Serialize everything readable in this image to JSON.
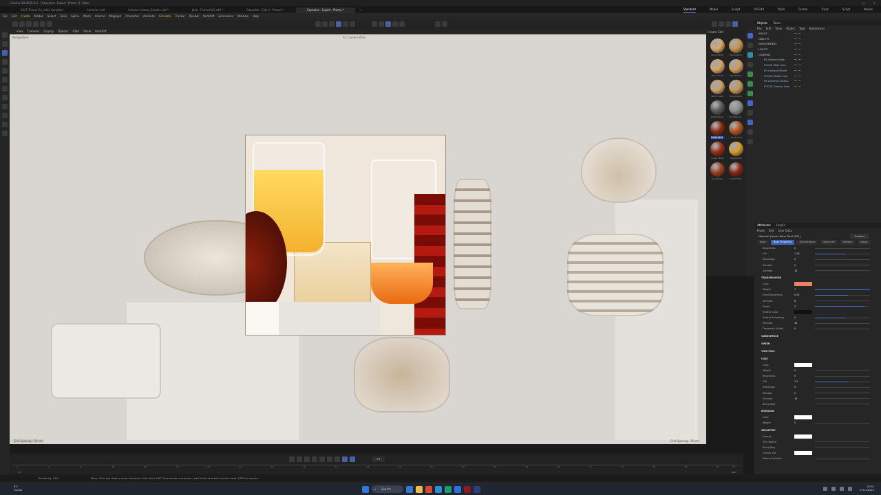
{
  "window": {
    "title": "Cinema 4D 2025.0.2 - [Capsules - Liquid - Promo *] - Main",
    "controls": [
      "–",
      "□",
      "✕"
    ]
  },
  "tabs": [
    {
      "label": "2025 Tennis Vs_video Sampled",
      "active": false
    },
    {
      "label": "Cameras c4d",
      "active": false
    },
    {
      "label": "Autumn Leaves_Shader.c4d *",
      "active": false
    },
    {
      "label": "Jello - Frames%C.c4d *",
      "active": false
    },
    {
      "label": "Capsules - Fabric - Promo *",
      "active": false
    },
    {
      "label": "Capsules - Liquid - Promo *",
      "active": true
    },
    {
      "label": "+",
      "active": false
    }
  ],
  "layouts": [
    {
      "label": "Standard",
      "active": true
    },
    {
      "label": "Model",
      "active": false
    },
    {
      "label": "Sculpt",
      "active": false
    },
    {
      "label": "UV Edit",
      "active": false
    },
    {
      "label": "Paint",
      "active": false
    },
    {
      "label": "Groom",
      "active": false
    },
    {
      "label": "Track",
      "active": false
    },
    {
      "label": "Script",
      "active": false
    },
    {
      "label": "Nodes",
      "active": false
    }
  ],
  "menubar": [
    "File",
    "Edit",
    "Create",
    "Modes",
    "Select",
    "Tools",
    "Spline",
    "Mesh",
    "Volume",
    "Mograph",
    "Character",
    "Animate",
    "Simulate",
    "Tracker",
    "Render",
    "Redshift",
    "Extensions",
    "Window",
    "Help"
  ],
  "viewport": {
    "menu": [
      "View",
      "Cameras",
      "Display",
      "Options",
      "Filter",
      "Panel",
      "Redshift"
    ],
    "label": "Perspective",
    "camera": "RS Camera Wide",
    "status_left": "Grid Spacing : 50 cm",
    "status_right": "Grid Spacing : 50 cm"
  },
  "materials": {
    "tabs": [
      "Create",
      "Edit"
    ],
    "items": [
      {
        "label": "Wood Wirth",
        "color": "#d8a866"
      },
      {
        "label": "Wood Wirth",
        "color": "#c9924f"
      },
      {
        "label": "Wood Scatt",
        "color": "#d4a462"
      },
      {
        "label": "Wood Birch",
        "color": "#cf9c5c"
      },
      {
        "label": "Wood Scatt",
        "color": "#caa066"
      },
      {
        "label": "Wood Tooth",
        "color": "#c7975a"
      },
      {
        "label": "Plaster Base",
        "color": "#5a5a5a"
      },
      {
        "label": "RS Material",
        "color": "#8b8b8b"
      },
      {
        "label": "Liquid Wine",
        "color": "#8e2a10",
        "selected": true
      },
      {
        "label": "Liquid Hona",
        "color": "#b4501b"
      },
      {
        "label": "Liquid Wine",
        "color": "#9a2e14"
      },
      {
        "label": "Liquid Gold",
        "color": "#d79a2a"
      },
      {
        "label": "Liquid beer",
        "color": "#9b3c1c"
      },
      {
        "label": "Liquid Wine",
        "color": "#8a2411"
      }
    ]
  },
  "objects": {
    "tabs": [
      "Objects",
      "Takes"
    ],
    "menu": [
      "File",
      "Edit",
      "View",
      "Object",
      "Tags",
      "Bookmarks"
    ],
    "rows": [
      {
        "label": "ABOUT",
        "child": false
      },
      {
        "label": "OBJECTS",
        "child": false
      },
      {
        "label": "ENVIRONMENT",
        "child": false
      },
      {
        "label": "LIGHTS",
        "child": false
      },
      {
        "label": "CAMERAS",
        "child": false
      },
      {
        "label": "RS Camera Wide",
        "child": true
      },
      {
        "label": "FOCUS Wide Cam",
        "child": true
      },
      {
        "label": "RS Camera Middle",
        "child": true
      },
      {
        "label": "FOCUS Middle Cam",
        "child": true
      },
      {
        "label": "RS Camera Closeup",
        "child": true
      },
      {
        "label": "FOCUS Closeup Cam",
        "child": true
      }
    ]
  },
  "attributes": {
    "tabs": [
      "Attributes",
      "Layers"
    ],
    "menu": [
      "Mode",
      "Edit",
      "User Data"
    ],
    "material_label": "Material [Liquid Wine Rosé (RT)]",
    "preset": "Custom",
    "subtabs": [
      {
        "label": "Basic",
        "active": false
      },
      {
        "label": "Base Properties",
        "active": true
      },
      {
        "label": "Optimizations",
        "active": false
      },
      {
        "label": "Advanced",
        "active": false
      },
      {
        "label": "Viewport",
        "active": false
      },
      {
        "label": "Assign",
        "active": false
      }
    ],
    "sections": [
      {
        "title": "",
        "rows": [
          {
            "label": "Roughness",
            "value": "0",
            "slider": 0
          },
          {
            "label": "IOR",
            "value": "1.33",
            "slider": 0.55
          },
          {
            "label": "Anisotropy",
            "value": "0",
            "slider": 0
          },
          {
            "label": "Rotation",
            "value": "0",
            "slider": 0
          },
          {
            "label": "Samples",
            "value": "16",
            "slider": 0
          }
        ]
      },
      {
        "title": "TRANSMISSION",
        "rows": [
          {
            "label": "Color",
            "swatch": "#ef7f68"
          },
          {
            "label": "Weight",
            "value": "1",
            "slider": 1
          },
          {
            "label": "Extra Roughness",
            "value": "0.25",
            "slider": 0.6
          },
          {
            "label": "Samples",
            "value": "8",
            "slider": 0
          },
          {
            "label": "Depth",
            "value": "3",
            "slider": 0.9
          },
          {
            "label": "Scatter Color",
            "swatch": "#111111"
          },
          {
            "label": "Scatter Anisotropy",
            "value": "0",
            "slider": 0.55
          },
          {
            "label": "Samples",
            "value": "16",
            "slider": 0
          },
          {
            "label": "Dispersion (Abbe)",
            "value": "0",
            "slider": 0
          }
        ]
      },
      {
        "title": "SUBSURFACE",
        "rows": []
      },
      {
        "title": "SHEEN",
        "rows": []
      },
      {
        "title": "THIN FILM",
        "rows": []
      },
      {
        "title": "COAT",
        "rows": [
          {
            "label": "Color",
            "swatch": "#ffffff"
          },
          {
            "label": "Weight",
            "value": "0",
            "slider": 0
          },
          {
            "label": "Roughness",
            "value": "0",
            "slider": 0
          },
          {
            "label": "IOR",
            "value": "1.5",
            "slider": 0.6
          },
          {
            "label": "Anisotropy",
            "value": "0",
            "slider": 0
          },
          {
            "label": "Rotation",
            "value": "0",
            "slider": 0
          },
          {
            "label": "Samples",
            "value": "16",
            "slider": 0
          },
          {
            "label": "Bump Map",
            "value": "",
            "slider": 0
          }
        ]
      },
      {
        "title": "EMISSION",
        "rows": [
          {
            "label": "Color",
            "swatch": "#ffffff"
          },
          {
            "label": "Weight",
            "value": "0",
            "slider": 0
          }
        ]
      },
      {
        "title": "GEOMETRY",
        "rows": [
          {
            "label": "Opacity",
            "swatch": "#ffffff"
          },
          {
            "label": "Thin Walled",
            "value": "",
            "slider": 0
          },
          {
            "label": "Bump Map",
            "value": "",
            "slider": 0
          },
          {
            "label": "Overall Tint",
            "swatch": "#ffffff"
          },
          {
            "label": "Affects Emission",
            "value": "",
            "slider": 0
          }
        ]
      }
    ]
  },
  "timeline": {
    "frame": "0 F",
    "start": "0 F",
    "end": "90 F",
    "ticks": [
      "0",
      "4",
      "8",
      "12",
      "16",
      "20",
      "24",
      "28",
      "32",
      "36",
      "40",
      "44",
      "48",
      "52",
      "56",
      "60",
      "64",
      "68",
      "72",
      "76",
      "80",
      "84",
      "88",
      "90"
    ]
  },
  "status": {
    "render": "Rendering: 12%",
    "message": "Move: Click and drag to move elements. Hold down SHIFT to quantize movement / add to the selection in point mode, CTRL to remove."
  },
  "taskbar": {
    "weather_temp": "6°C",
    "weather_desc": "Cloudy",
    "search": "Search",
    "time": "07:32",
    "date": "07/11/2024",
    "apps": [
      "#2e7bd6",
      "#f0b94a",
      "#d9472b",
      "#2c8fd6",
      "#1f9a6b",
      "#2a6fe0",
      "#8a1c1c",
      "#2b3f7a"
    ]
  }
}
